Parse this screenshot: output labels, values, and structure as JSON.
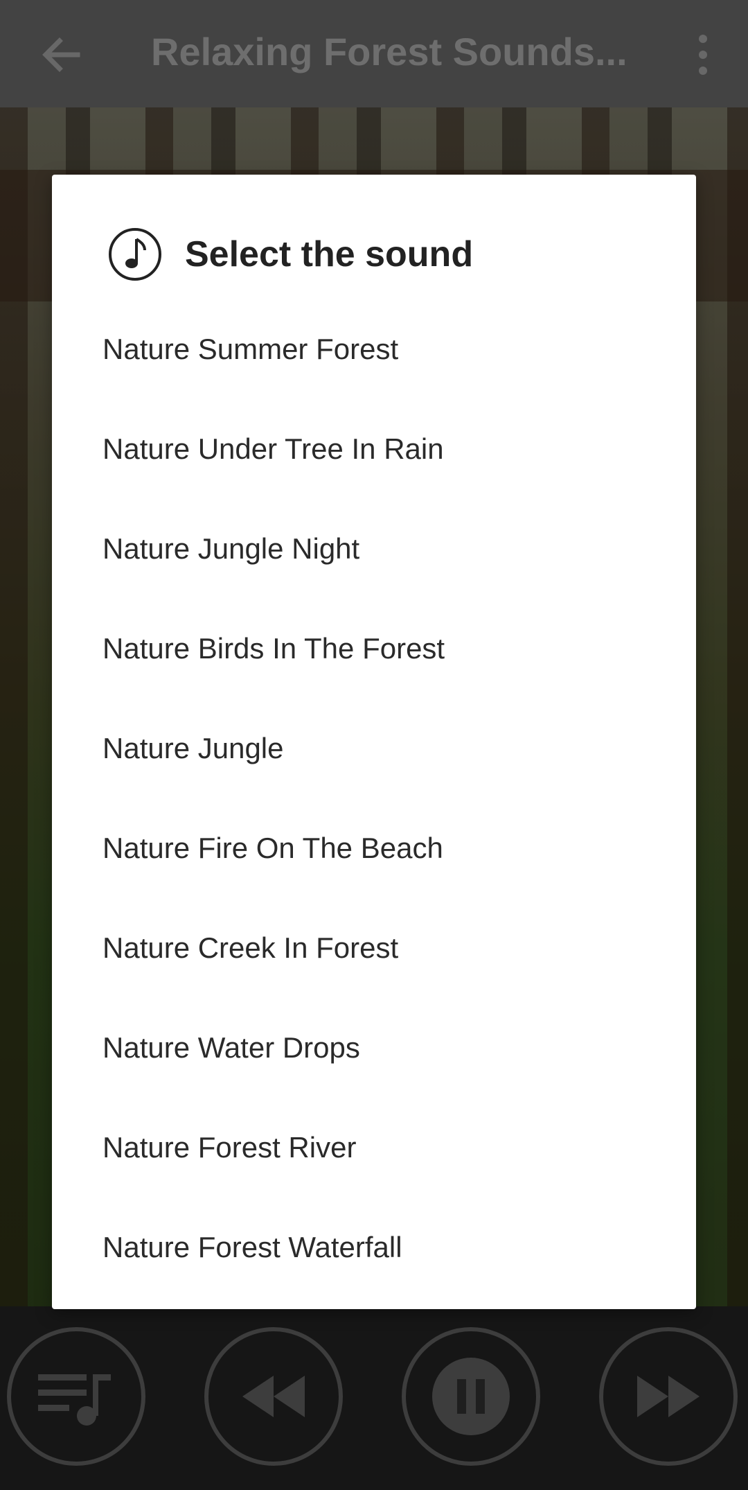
{
  "app_bar": {
    "title": "Relaxing Forest Sounds...",
    "back_icon": "arrow-left-icon",
    "menu_icon": "more-vert-icon"
  },
  "dialog": {
    "icon": "music-note-icon",
    "title": "Select the sound",
    "items": [
      "Nature Summer Forest",
      "Nature Under Tree In Rain",
      "Nature Jungle Night",
      "Nature Birds In The Forest",
      "Nature Jungle",
      "Nature Fire On The Beach",
      "Nature Creek In Forest",
      "Nature Water Drops",
      "Nature Forest River",
      "Nature Forest Waterfall"
    ]
  },
  "controls": [
    {
      "icon": "playlist-icon"
    },
    {
      "icon": "rewind-icon"
    },
    {
      "icon": "pause-icon"
    },
    {
      "icon": "fast-forward-icon"
    }
  ],
  "colors": {
    "scrim": "#000000",
    "dialog_bg": "#ffffff",
    "title_text": "#222222",
    "item_text": "#2a2a2a"
  }
}
